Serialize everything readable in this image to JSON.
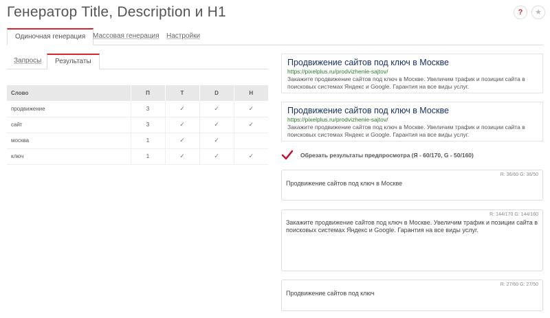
{
  "header": {
    "title": "Генератор Title, Description и H1",
    "help_label": "?",
    "star_label": "★"
  },
  "main_tabs": [
    {
      "label": "Одиночная генерация",
      "active": true
    },
    {
      "label": "Массовая генерация",
      "active": false
    },
    {
      "label": "Настройки",
      "active": false
    }
  ],
  "sub_tabs": [
    {
      "label": "Запросы",
      "active": false
    },
    {
      "label": "Результаты",
      "active": true
    }
  ],
  "table": {
    "headers": [
      "Слово",
      "П",
      "T",
      "D",
      "H"
    ],
    "rows": [
      {
        "word": "продвижение",
        "count": "3",
        "t": "✓",
        "d": "✓",
        "h": "✓"
      },
      {
        "word": "сайт",
        "count": "3",
        "t": "✓",
        "d": "✓",
        "h": "✓"
      },
      {
        "word": "москва",
        "count": "1",
        "t": "✓",
        "d": "✓",
        "h": ""
      },
      {
        "word": "ключ",
        "count": "1",
        "t": "✓",
        "d": "✓",
        "h": "✓"
      }
    ]
  },
  "previews": [
    {
      "title": "Продвижение сайтов под ключ в Москве",
      "url": "https://pixelplus.ru/prodvizhenie-sajtov/",
      "desc_line1": "Закажите продвижение сайтов под ключ в Москве. Увеличим трафик и позиции сайта в",
      "desc_line2": "поисковых системах Яндекс и Google. Гарантия на все виды услуг."
    },
    {
      "title": "Продвижение сайтов под ключ в Москве",
      "url": "https://pixelplus.ru/prodvizhenie-sajtov/",
      "desc_line1": "Закажите продвижение сайтов под ключ в Москве. Увеличим трафик и позиции сайта в",
      "desc_line2": "поисковых системах Яндекс и Google. Гарантия на все виды услуг."
    }
  ],
  "crop": {
    "label": "Обрезать результаты предпросмотра (Я - 60/170, G - 50/160)",
    "checked": true
  },
  "fields": {
    "title": {
      "counter": "R: 36/60  G: 36/50",
      "value": "Продвижение сайтов под ключ в Москве"
    },
    "description": {
      "counter": "R: 144/170  G: 144/160",
      "value_line1": "Закажите продвижение сайтов под ключ в Москве. Увеличим трафик и позиции сайта в",
      "value_line2": "поисковых системах Яндекс и Google. Гарантия на все виды услуг."
    },
    "h1": {
      "counter": "R: 27/60  G: 27/50",
      "value": "Продвижение сайтов под ключ"
    }
  },
  "colors": {
    "accent": "#d9262b",
    "check": "#c8102e",
    "link": "#1a3366",
    "url": "#2a7a2a"
  }
}
